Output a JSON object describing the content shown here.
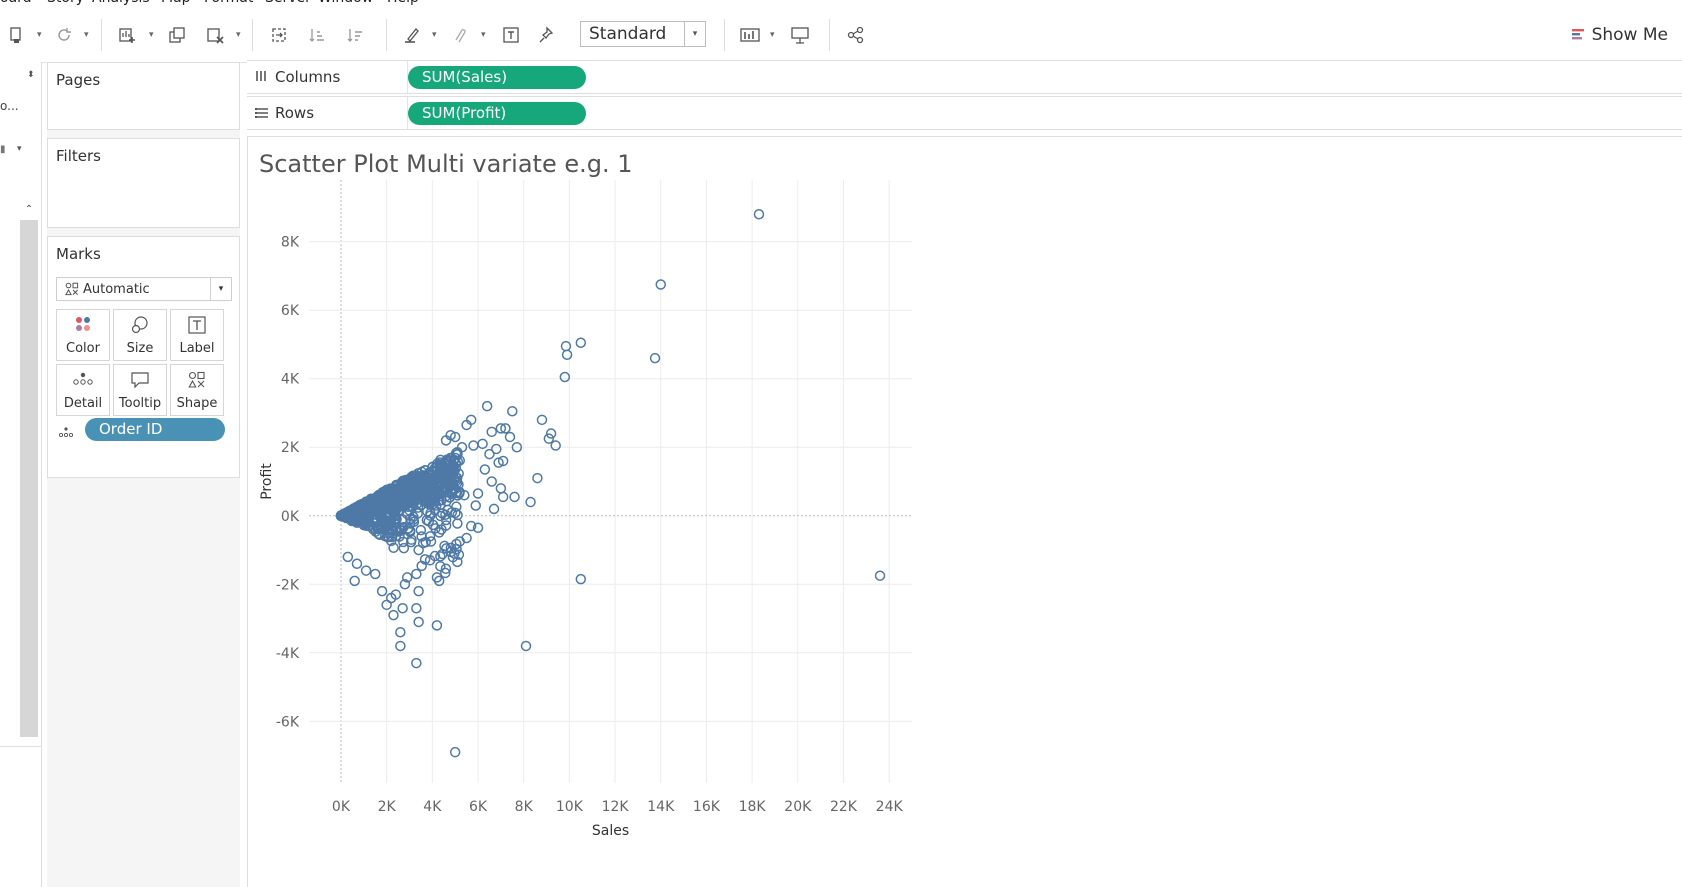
{
  "menu": [
    "oard",
    "Story",
    "Analysis",
    "Map",
    "Format",
    "Server",
    "Window",
    "Help"
  ],
  "toolbar": {
    "standard_label": "Standard",
    "show_me_label": "Show Me",
    "icons": [
      "datasource-icon",
      "refresh-icon",
      "new-worksheet-icon",
      "duplicate-icon",
      "clear-icon",
      "swap-icon",
      "sort-asc-icon",
      "sort-desc-icon",
      "highlight-icon",
      "group-icon",
      "label-icon",
      "pin-icon",
      "chart-icon",
      "presentation-icon",
      "share-icon"
    ]
  },
  "shelves": {
    "pages_label": "Pages",
    "filters_label": "Filters",
    "marks_label": "Marks",
    "mark_type": "Automatic",
    "mark_buttons": [
      "Color",
      "Size",
      "Label",
      "Detail",
      "Tooltip",
      "Shape"
    ],
    "detail_pill": "Order ID",
    "columns_label": "Columns",
    "rows_label": "Rows",
    "columns_pill": "SUM(Sales)",
    "rows_pill": "SUM(Profit)"
  },
  "sheet": {
    "title": "Scatter Plot Multi variate e.g. 1"
  },
  "colors": {
    "mark": "#4e79a7",
    "pill_green": "#16a77a",
    "pill_blue": "#4a92b5"
  },
  "chart_data": {
    "type": "scatter",
    "title": "Scatter Plot Multi variate e.g. 1",
    "xlabel": "Sales",
    "ylabel": "Profit",
    "xlim": [
      -1400,
      25000
    ],
    "ylim": [
      -7800,
      9800
    ],
    "x_ticks": [
      "0K",
      "2K",
      "4K",
      "6K",
      "8K",
      "10K",
      "12K",
      "14K",
      "16K",
      "18K",
      "20K",
      "22K",
      "24K"
    ],
    "y_ticks": [
      "8K",
      "6K",
      "4K",
      "2K",
      "0K",
      "-2K",
      "-4K",
      "-6K"
    ],
    "x_tick_values": [
      0,
      2000,
      4000,
      6000,
      8000,
      10000,
      12000,
      14000,
      16000,
      18000,
      20000,
      22000,
      24000
    ],
    "y_tick_values": [
      8000,
      6000,
      4000,
      2000,
      0,
      -2000,
      -4000,
      -6000
    ],
    "points": [
      [
        18300,
        8800
      ],
      [
        14000,
        6750
      ],
      [
        10500,
        5050
      ],
      [
        9850,
        4950
      ],
      [
        9900,
        4700
      ],
      [
        13750,
        4600
      ],
      [
        9800,
        4050
      ],
      [
        6400,
        3200
      ],
      [
        7500,
        3050
      ],
      [
        5700,
        2800
      ],
      [
        5500,
        2650
      ],
      [
        8800,
        2800
      ],
      [
        9200,
        2400
      ],
      [
        9100,
        2250
      ],
      [
        9400,
        2050
      ],
      [
        6600,
        2450
      ],
      [
        7000,
        2550
      ],
      [
        7200,
        2550
      ],
      [
        7400,
        2300
      ],
      [
        7700,
        2000
      ],
      [
        5000,
        2300
      ],
      [
        4600,
        2200
      ],
      [
        4800,
        2350
      ],
      [
        5300,
        2000
      ],
      [
        5800,
        2050
      ],
      [
        6200,
        2100
      ],
      [
        6800,
        1950
      ],
      [
        7100,
        1600
      ],
      [
        6500,
        1800
      ],
      [
        6300,
        1350
      ],
      [
        6900,
        1550
      ],
      [
        7600,
        550
      ],
      [
        8600,
        1100
      ],
      [
        8300,
        400
      ],
      [
        7000,
        800
      ],
      [
        7100,
        550
      ],
      [
        6600,
        1000
      ],
      [
        6000,
        650
      ],
      [
        6700,
        200
      ],
      [
        5900,
        300
      ],
      [
        5400,
        600
      ],
      [
        5700,
        -300
      ],
      [
        6000,
        -350
      ],
      [
        5500,
        -650
      ],
      [
        5200,
        -750
      ],
      [
        4400,
        -400
      ],
      [
        3900,
        -600
      ],
      [
        3600,
        -800
      ],
      [
        3400,
        -1000
      ],
      [
        3900,
        -1300
      ],
      [
        4200,
        -1800
      ],
      [
        4300,
        -1900
      ],
      [
        3300,
        -1700
      ],
      [
        2900,
        -1800
      ],
      [
        2800,
        -2000
      ],
      [
        3400,
        -2200
      ],
      [
        2400,
        -2300
      ],
      [
        2200,
        -2400
      ],
      [
        2000,
        -2600
      ],
      [
        2700,
        -2700
      ],
      [
        2300,
        -2900
      ],
      [
        3300,
        -2700
      ],
      [
        3400,
        -3100
      ],
      [
        4200,
        -3200
      ],
      [
        2600,
        -3400
      ],
      [
        2600,
        -3800
      ],
      [
        3300,
        -4300
      ],
      [
        8100,
        -3800
      ],
      [
        10500,
        -1850
      ],
      [
        23600,
        -1750
      ],
      [
        5000,
        -6900
      ],
      [
        600,
        -1900
      ],
      [
        1100,
        -1600
      ],
      [
        1800,
        -2200
      ],
      [
        1500,
        -1700
      ],
      [
        700,
        -1400
      ],
      [
        300,
        -1200
      ]
    ]
  }
}
